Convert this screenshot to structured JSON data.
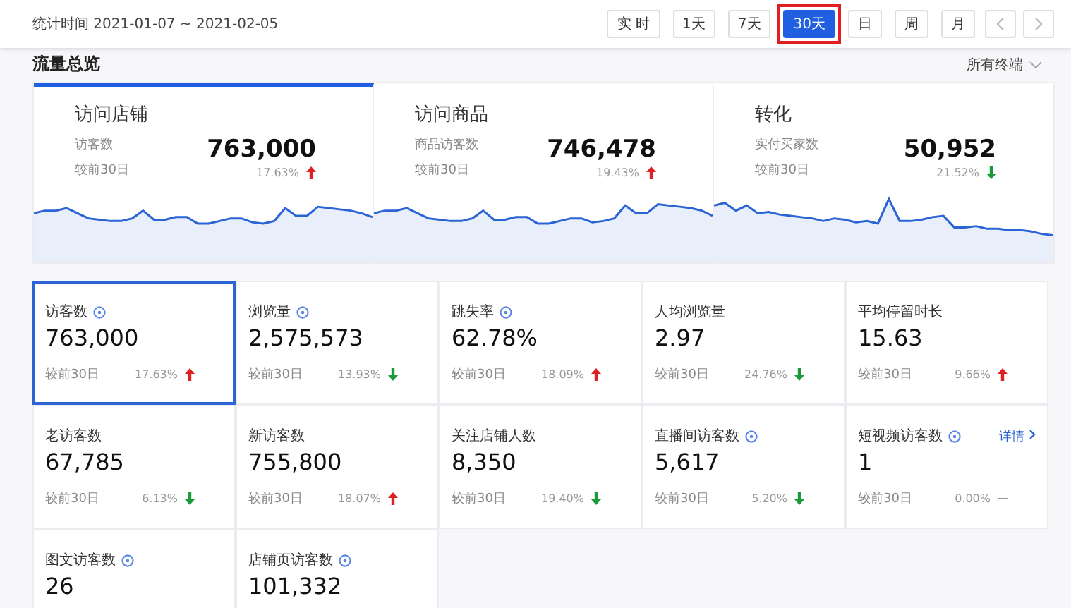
{
  "header": {
    "period_label": "统计时间",
    "period": "2021-01-07 ~ 2021-02-05",
    "range_buttons": [
      {
        "label": "实 时",
        "selected": false,
        "highlighted": false
      },
      {
        "label": "1天",
        "selected": false,
        "highlighted": false
      },
      {
        "label": "7天",
        "selected": false,
        "highlighted": false
      },
      {
        "label": "30天",
        "selected": true,
        "highlighted": true
      },
      {
        "label": "日",
        "selected": false,
        "highlighted": false
      },
      {
        "label": "周",
        "selected": false,
        "highlighted": false
      },
      {
        "label": "月",
        "selected": false,
        "highlighted": false
      }
    ]
  },
  "section": {
    "title": "流量总览",
    "filter": "所有终端"
  },
  "overview": [
    {
      "title": "访问店铺",
      "metric_label": "访客数",
      "value": "763,000",
      "compare_label": "较前30日",
      "change": "17.63%",
      "kind": "up",
      "selected": true
    },
    {
      "title": "访问商品",
      "metric_label": "商品访客数",
      "value": "746,478",
      "compare_label": "较前30日",
      "change": "19.43%",
      "kind": "up",
      "selected": false
    },
    {
      "title": "转化",
      "metric_label": "实付买家数",
      "value": "50,952",
      "compare_label": "较前30日",
      "change": "21.52%",
      "kind": "down",
      "selected": false
    }
  ],
  "metrics": [
    {
      "label": "访客数",
      "info": true,
      "value": "763,000",
      "compare_label": "较前30日",
      "change": "17.63%",
      "kind": "up",
      "selected": true
    },
    {
      "label": "浏览量",
      "info": true,
      "value": "2,575,573",
      "compare_label": "较前30日",
      "change": "13.93%",
      "kind": "down",
      "selected": false
    },
    {
      "label": "跳失率",
      "info": true,
      "value": "62.78%",
      "compare_label": "较前30日",
      "change": "18.09%",
      "kind": "up",
      "selected": false
    },
    {
      "label": "人均浏览量",
      "info": false,
      "value": "2.97",
      "compare_label": "较前30日",
      "change": "24.76%",
      "kind": "down",
      "selected": false
    },
    {
      "label": "平均停留时长",
      "info": false,
      "value": "15.63",
      "compare_label": "较前30日",
      "change": "9.66%",
      "kind": "up",
      "selected": false
    },
    {
      "label": "老访客数",
      "info": false,
      "value": "67,785",
      "compare_label": "较前30日",
      "change": "6.13%",
      "kind": "down",
      "selected": false
    },
    {
      "label": "新访客数",
      "info": false,
      "value": "755,800",
      "compare_label": "较前30日",
      "change": "18.07%",
      "kind": "up",
      "selected": false
    },
    {
      "label": "关注店铺人数",
      "info": false,
      "value": "8,350",
      "compare_label": "较前30日",
      "change": "19.40%",
      "kind": "down",
      "selected": false
    },
    {
      "label": "直播间访客数",
      "info": true,
      "value": "5,617",
      "compare_label": "较前30日",
      "change": "5.20%",
      "kind": "down",
      "selected": false
    },
    {
      "label": "短视频访客数",
      "info": true,
      "value": "1",
      "compare_label": "较前30日",
      "change": "0.00%",
      "kind": "flat",
      "selected": false,
      "link": "详情"
    },
    {
      "label": "图文访客数",
      "info": true,
      "value": "26",
      "selected": false
    },
    {
      "label": "店铺页访客数",
      "info": true,
      "value": "101,332",
      "selected": false
    }
  ]
}
